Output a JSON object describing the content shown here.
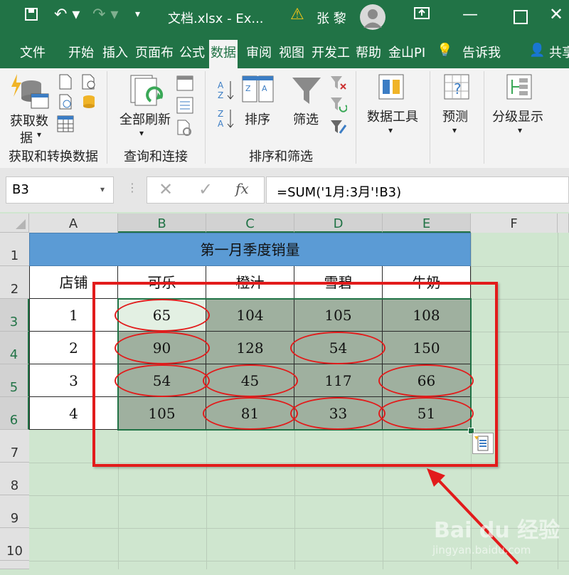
{
  "titlebar": {
    "filename": "文档.xlsx  -  Ex...",
    "user": "张 黎"
  },
  "tabs": [
    "文件",
    "开始",
    "插入",
    "页面布",
    "公式",
    "数据",
    "审阅",
    "视图",
    "开发工",
    "帮助",
    "金山PI",
    "告诉我",
    "共享"
  ],
  "active_tab": "数据",
  "ribbon": {
    "get_data": "获取数",
    "get_data2": "据",
    "refresh_all": "全部刷新",
    "sort": "排序",
    "filter": "筛选",
    "data_tools": "数据工具",
    "forecast": "预测",
    "outline": "分级显示",
    "group1": "获取和转换数据",
    "group2": "查询和连接",
    "group3": "排序和筛选"
  },
  "formula_bar": {
    "name_box": "B3",
    "fx": "fx",
    "formula": "=SUM('1月:3月'!B3)"
  },
  "columns": [
    "A",
    "B",
    "C",
    "D",
    "E",
    "F"
  ],
  "rows": [
    "1",
    "2",
    "3",
    "4",
    "5",
    "6",
    "7",
    "8",
    "9",
    "10"
  ],
  "sheet": {
    "title": "第一月季度销量",
    "headers": [
      "店铺",
      "可乐",
      "橙汁",
      "雪碧",
      "牛奶"
    ],
    "data": [
      [
        "1",
        "65",
        "104",
        "105",
        "108"
      ],
      [
        "2",
        "90",
        "128",
        "54",
        "150"
      ],
      [
        "3",
        "54",
        "45",
        "117",
        "66"
      ],
      [
        "4",
        "105",
        "81",
        "33",
        "51"
      ]
    ]
  },
  "watermark": {
    "brand": "Bai du 经验",
    "url": "jingyan.baidu.com"
  },
  "colors": {
    "excel_green": "#217346",
    "header_blue": "#5b9bd5",
    "highlight_red": "#e21b1b",
    "selection_gray": "#9fb09f"
  }
}
